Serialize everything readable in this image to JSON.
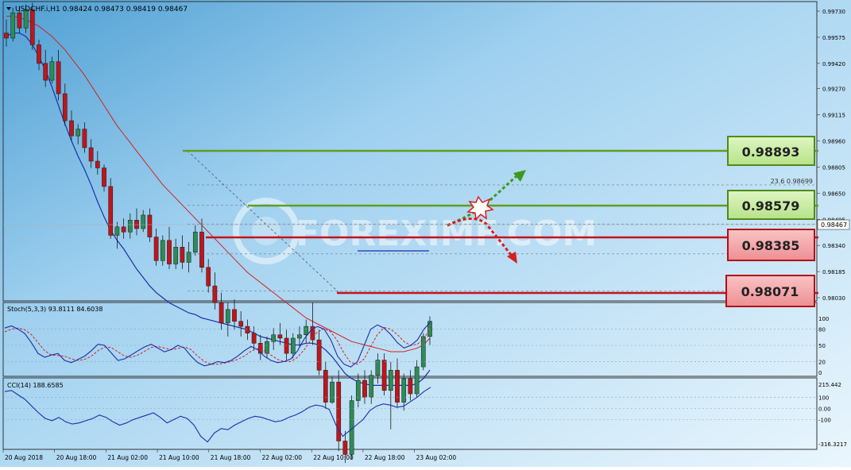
{
  "symbol_header": {
    "text": "USDCHF.i,H1  0.98424 0.98473 0.98419 0.98467"
  },
  "watermark": {
    "text": "FOREXIMF.COM"
  },
  "fib_label": {
    "text": "23.6 0.98699"
  },
  "price_tags": [
    {
      "text": "0.98893",
      "kind": "resistance"
    },
    {
      "text": "0.98579",
      "kind": "resistance"
    },
    {
      "text": "0.98385",
      "kind": "support"
    },
    {
      "text": "0.98071",
      "kind": "support"
    }
  ],
  "stoch_label": {
    "text": "Stoch(5,3,3) 93.8111 84.6038"
  },
  "cci_label": {
    "text": "CCI(14) 188.6585"
  },
  "colors": {
    "background_top": "#5aa7d6",
    "background_bottom": "#e4f2fb",
    "bull_candle": "#2e8b57",
    "bear_candle": "#c0151b",
    "ma_fast": "#1c2fa8",
    "ma_slow": "#d42020",
    "resistance": "#5f9e1f",
    "support": "#c8101a",
    "tag_green_fill": "#c6eba1",
    "tag_red_fill": "#f2a3a6"
  },
  "chart_data": [
    {
      "type": "candlestick",
      "y_axis_ticks": [
        "0.99730",
        "0.99575",
        "0.99420",
        "0.99270",
        "0.99115",
        "0.98960",
        "0.98805",
        "0.98650",
        "0.98495",
        "0.98340",
        "0.98185",
        "0.98030"
      ],
      "ylim": [
        0.9795,
        0.9981
      ],
      "current_price": "0.98467",
      "x_axis_ticks": [
        "20 Aug 2018",
        "20 Aug 18:00",
        "21 Aug 02:00",
        "21 Aug 10:00",
        "21 Aug 18:00",
        "22 Aug 02:00",
        "22 Aug 10:00",
        "22 Aug 18:00",
        "23 Aug 02:00"
      ],
      "levels": [
        {
          "label": "0.98893",
          "value": 0.98893,
          "kind": "resistance"
        },
        {
          "label": "0.98579",
          "value": 0.98579,
          "kind": "resistance"
        },
        {
          "label": "0.98385",
          "value": 0.98385,
          "kind": "support"
        },
        {
          "label": "0.98071",
          "value": 0.98071,
          "kind": "support"
        }
      ],
      "fib_levels": [
        0.98699,
        0.98579,
        0.98467,
        0.9829,
        0.98071
      ],
      "candles": [
        [
          0.996,
          0.9968,
          0.9952,
          0.9957
        ],
        [
          0.9957,
          0.9975,
          0.9955,
          0.9972
        ],
        [
          0.9972,
          0.9976,
          0.996,
          0.9963
        ],
        [
          0.9963,
          0.9977,
          0.996,
          0.9974
        ],
        [
          0.9974,
          0.9978,
          0.995,
          0.9953
        ],
        [
          0.9953,
          0.9956,
          0.9938,
          0.9942
        ],
        [
          0.9942,
          0.995,
          0.9928,
          0.9932
        ],
        [
          0.9932,
          0.9946,
          0.993,
          0.9943
        ],
        [
          0.9943,
          0.995,
          0.992,
          0.9924
        ],
        [
          0.9924,
          0.993,
          0.9905,
          0.9908
        ],
        [
          0.9908,
          0.9914,
          0.9896,
          0.9899
        ],
        [
          0.9899,
          0.9906,
          0.9894,
          0.9903
        ],
        [
          0.9903,
          0.9907,
          0.9889,
          0.9892
        ],
        [
          0.9892,
          0.9897,
          0.988,
          0.9884
        ],
        [
          0.9884,
          0.989,
          0.9876,
          0.988
        ],
        [
          0.988,
          0.9882,
          0.9866,
          0.9869
        ],
        [
          0.9869,
          0.9874,
          0.9838,
          0.984
        ],
        [
          0.984,
          0.9848,
          0.9832,
          0.9845
        ],
        [
          0.9845,
          0.985,
          0.9838,
          0.9842
        ],
        [
          0.9842,
          0.9853,
          0.9838,
          0.9849
        ],
        [
          0.9849,
          0.9856,
          0.984,
          0.9844
        ],
        [
          0.9844,
          0.9855,
          0.9842,
          0.9852
        ],
        [
          0.9852,
          0.9856,
          0.9836,
          0.9839
        ],
        [
          0.9839,
          0.9844,
          0.9822,
          0.9825
        ],
        [
          0.9825,
          0.984,
          0.9822,
          0.9837
        ],
        [
          0.9837,
          0.9845,
          0.982,
          0.9823
        ],
        [
          0.9823,
          0.9838,
          0.982,
          0.9833
        ],
        [
          0.9833,
          0.984,
          0.982,
          0.9824
        ],
        [
          0.9824,
          0.9836,
          0.9818,
          0.983
        ],
        [
          0.983,
          0.9846,
          0.9828,
          0.9842
        ],
        [
          0.9842,
          0.985,
          0.9818,
          0.9821
        ],
        [
          0.9821,
          0.9826,
          0.9806,
          0.981
        ],
        [
          0.981,
          0.9818,
          0.9796,
          0.98
        ],
        [
          0.98,
          0.9806,
          0.9784,
          0.9788
        ],
        [
          0.9788,
          0.98,
          0.978,
          0.9796
        ],
        [
          0.9796,
          0.9802,
          0.9784,
          0.9789
        ],
        [
          0.9789,
          0.9795,
          0.978,
          0.9786
        ],
        [
          0.9786,
          0.979,
          0.9778,
          0.9782
        ],
        [
          0.9782,
          0.9786,
          0.9772,
          0.9776
        ],
        [
          0.9776,
          0.9781,
          0.9766,
          0.977
        ],
        [
          0.977,
          0.978,
          0.9767,
          0.9777
        ],
        [
          0.9777,
          0.9785,
          0.9772,
          0.9781
        ],
        [
          0.9781,
          0.9788,
          0.9775,
          0.9779
        ],
        [
          0.9779,
          0.9784,
          0.9766,
          0.977
        ],
        [
          0.977,
          0.9782,
          0.9767,
          0.9779
        ],
        [
          0.9779,
          0.9786,
          0.9774,
          0.9781
        ],
        [
          0.9781,
          0.979,
          0.9776,
          0.9786
        ],
        [
          0.9786,
          0.98,
          0.9775,
          0.9778
        ],
        [
          0.9778,
          0.9784,
          0.9757,
          0.976
        ],
        [
          0.976,
          0.9765,
          0.9737,
          0.9741
        ],
        [
          0.9741,
          0.9756,
          0.974,
          0.9753
        ],
        [
          0.9753,
          0.976,
          0.9712,
          0.9718
        ],
        [
          0.9718,
          0.9724,
          0.9705,
          0.971
        ],
        [
          0.971,
          0.9745,
          0.9707,
          0.9742
        ],
        [
          0.9742,
          0.9758,
          0.9738,
          0.9754
        ],
        [
          0.9754,
          0.976,
          0.974,
          0.9744
        ],
        [
          0.9744,
          0.976,
          0.974,
          0.9757
        ],
        [
          0.9757,
          0.977,
          0.9752,
          0.9766
        ],
        [
          0.9766,
          0.977,
          0.9745,
          0.9748
        ],
        [
          0.9748,
          0.9765,
          0.9725,
          0.976
        ],
        [
          0.976,
          0.9767,
          0.9738,
          0.9741
        ],
        [
          0.9741,
          0.9758,
          0.9736,
          0.9755
        ],
        [
          0.9755,
          0.976,
          0.9742,
          0.9746
        ],
        [
          0.9746,
          0.9766,
          0.9744,
          0.9762
        ],
        [
          0.9762,
          0.9782,
          0.976,
          0.978
        ],
        [
          0.978,
          0.9792,
          0.9775,
          0.9789
        ]
      ],
      "ma_fast": [
        0.9958,
        0.996,
        0.996,
        0.9958,
        0.9953,
        0.9946,
        0.9938,
        0.9928,
        0.9917,
        0.9906,
        0.9896,
        0.9887,
        0.9879,
        0.987,
        0.986,
        0.9851,
        0.9843,
        0.9837,
        0.9832,
        0.9826,
        0.982,
        0.9815,
        0.981,
        0.9806,
        0.9803,
        0.98,
        0.9798,
        0.9796,
        0.9794,
        0.9793,
        0.9791,
        0.979,
        0.9789,
        0.9788,
        0.9787,
        0.9786,
        0.9785,
        0.9784,
        0.9782,
        0.978,
        0.9779,
        0.9778,
        0.9777,
        0.9776,
        0.9775,
        0.9775,
        0.9776,
        0.9776,
        0.9775,
        0.9772,
        0.9768,
        0.9763,
        0.9758,
        0.9755,
        0.9753,
        0.9752,
        0.9751,
        0.9751,
        0.9751,
        0.9751,
        0.9751,
        0.9751,
        0.9751,
        0.9752,
        0.9755,
        0.976
      ],
      "ma_slow": [
        0.997,
        0.997,
        0.9969,
        0.9968,
        0.9966,
        0.9964,
        0.9961,
        0.9958,
        0.9954,
        0.995,
        0.9945,
        0.994,
        0.9935,
        0.9929,
        0.9923,
        0.9917,
        0.9911,
        0.9905,
        0.99,
        0.9895,
        0.989,
        0.9885,
        0.988,
        0.9875,
        0.987,
        0.9866,
        0.9862,
        0.9858,
        0.9854,
        0.985,
        0.9846,
        0.9842,
        0.9838,
        0.9834,
        0.983,
        0.9826,
        0.9822,
        0.9818,
        0.9815,
        0.9812,
        0.9809,
        0.9806,
        0.9803,
        0.98,
        0.9797,
        0.9794,
        0.9791,
        0.9789,
        0.9787,
        0.9785,
        0.9783,
        0.9781,
        0.9779,
        0.9777,
        0.9776,
        0.9775,
        0.9774,
        0.9773,
        0.9772,
        0.9771,
        0.9771,
        0.9771,
        0.9772,
        0.9773,
        0.9775,
        0.9779
      ]
    },
    {
      "type": "line",
      "title": "Stoch(5,3,3) 93.8111 84.6038",
      "y_axis_ticks": [
        "100",
        "80",
        "50",
        "20",
        "0"
      ],
      "ylim": [
        0,
        100
      ],
      "series": [
        {
          "name": "main",
          "values": [
            82,
            86,
            80,
            72,
            55,
            35,
            28,
            32,
            35,
            22,
            18,
            24,
            30,
            40,
            52,
            50,
            36,
            22,
            25,
            32,
            40,
            47,
            52,
            45,
            38,
            42,
            50,
            45,
            30,
            18,
            12,
            15,
            20,
            18,
            22,
            30,
            40,
            48,
            42,
            30,
            22,
            18,
            20,
            25,
            40,
            62,
            78,
            85,
            80,
            60,
            30,
            15,
            10,
            20,
            50,
            80,
            88,
            82,
            70,
            55,
            45,
            50,
            60,
            80,
            93.8
          ]
        },
        {
          "name": "signal",
          "values": [
            75,
            80,
            82,
            79,
            70,
            55,
            40,
            32,
            31,
            30,
            25,
            22,
            24,
            30,
            40,
            47,
            46,
            38,
            30,
            28,
            32,
            39,
            46,
            48,
            45,
            42,
            44,
            47,
            42,
            30,
            20,
            15,
            15,
            17,
            20,
            24,
            30,
            39,
            44,
            40,
            32,
            24,
            20,
            20,
            28,
            42,
            60,
            75,
            81,
            75,
            58,
            35,
            18,
            15,
            25,
            48,
            70,
            83,
            80,
            70,
            57,
            50,
            52,
            62,
            84.6
          ]
        }
      ]
    },
    {
      "type": "line",
      "title": "CCI(14) 188.6585",
      "y_axis_ticks": [
        "215.442",
        "100",
        "0.00",
        "-100",
        "-316.3217"
      ],
      "ylim": [
        -330,
        260
      ],
      "series": [
        {
          "name": "CCI(14)",
          "values": [
            150,
            160,
            120,
            80,
            20,
            -40,
            -90,
            -110,
            -80,
            -120,
            -140,
            -130,
            -110,
            -90,
            -60,
            -80,
            -120,
            -150,
            -130,
            -100,
            -80,
            -60,
            -40,
            -80,
            -130,
            -100,
            -70,
            -90,
            -150,
            -250,
            -300,
            -220,
            -180,
            -190,
            -150,
            -120,
            -90,
            -70,
            -80,
            -100,
            -120,
            -110,
            -80,
            -60,
            -30,
            10,
            30,
            20,
            -10,
            -150,
            -250,
            -200,
            -150,
            -100,
            -20,
            20,
            40,
            30,
            10,
            20,
            60,
            100,
            150,
            188.6
          ]
        }
      ]
    }
  ]
}
